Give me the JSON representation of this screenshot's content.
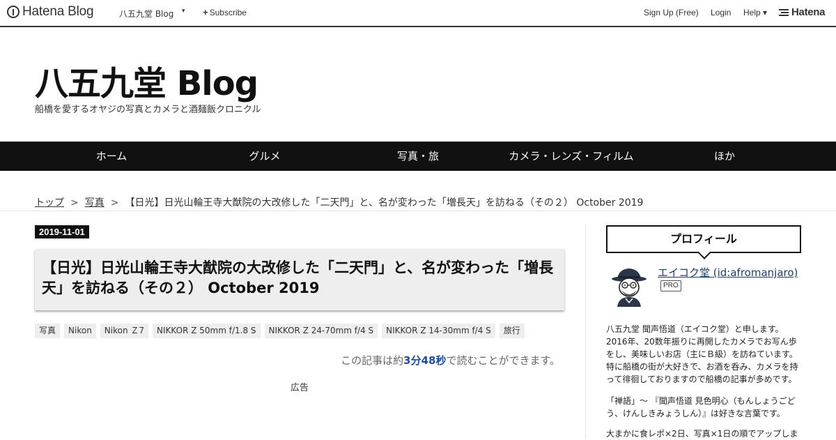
{
  "topbar": {
    "logo_text": "Hatena Blog",
    "blog_name": "八五九堂 Blog",
    "caret": "▾",
    "subscribe_label": "Subscribe",
    "signup_label": "Sign Up (Free)",
    "login_label": "Login",
    "help_label": "Help ▾",
    "hatena_label": "Hatena"
  },
  "header": {
    "title": "八五九堂 Blog",
    "description": "船橋を愛するオヤジの写真とカメラと酒麺飯クロニクル"
  },
  "nav": {
    "items": [
      "ホーム",
      "グルメ",
      "写真・旅",
      "カメラ・レンズ・フィルム",
      "ほか"
    ]
  },
  "breadcrumb": {
    "top": "トップ",
    "category": "写真",
    "separator": ">",
    "current": "【日光】日光山輪王寺大猷院の大改修した「二天門」と、名が変わった「増長天」を訪ねる（その２） October 2019"
  },
  "entry": {
    "date": "2019-11-01",
    "title": "【日光】日光山輪王寺大猷院の大改修した「二天門」と、名が変わった「増長天」を訪ねる（その２） October 2019",
    "tags": [
      "写真",
      "Nikon",
      "Nikon Ｚ7",
      "NIKKOR Z 50mm f/1.8 S",
      "NIKKOR Z 24-70mm f/4 S",
      "NIKKOR Z 14-30mm f/4 S",
      "旅行"
    ],
    "read_prefix": "この記事は約",
    "read_time": "3分48秒",
    "read_suffix": "で読むことができます。",
    "ad_label": "広告"
  },
  "sidebar": {
    "profile_heading": "プロフィール",
    "profile_name": "エイコク堂 (id:afromanjaro)",
    "pro_badge": "PRO",
    "paragraph1": "八五九堂 聞声悟道（エイコク堂）と申します。2016年、20数年振りに再開したカメラでお写ん歩をし、美味しいお店（主にＢ級）を訪ねています。特に船橋の街が大好きで、お酒を呑み、カメラを持って徘徊しておりますので船橋の記事が多めです。",
    "paragraph2": "「禅語」～ 『聞声悟道 見色明心（もんしょうごどう、けんしきみょうしん）』は好きな言葉です。",
    "paragraph3": "大まかに食レポ×2日、写真×1日の順でアップしま"
  },
  "icons": {
    "hatena_blog_logo": "hatena-blog-logo-icon",
    "plus": "plus-icon",
    "hatena_logo": "hatena-logo-icon",
    "avatar": "avatar-illustration"
  },
  "colors": {
    "nav_background": "#111111",
    "tag_background": "#eeeeee",
    "read_time_accent": "#1a4ea0",
    "profile_link": "#1a3f6f"
  }
}
